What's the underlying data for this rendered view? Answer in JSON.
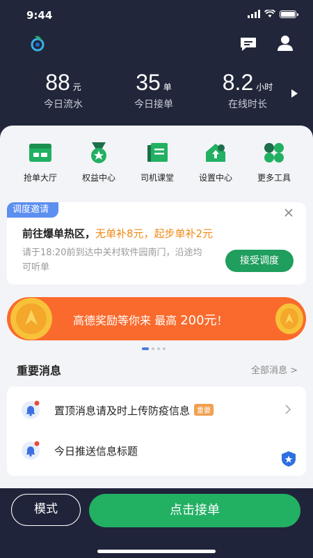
{
  "status": {
    "time": "9:44"
  },
  "stats": [
    {
      "value": "88",
      "unit": "元",
      "label": "今日流水"
    },
    {
      "value": "35",
      "unit": "单",
      "label": "今日接单"
    },
    {
      "value": "8.2",
      "unit": "小时",
      "label": "在线时长"
    }
  ],
  "tools": [
    {
      "label": "抢单大厅",
      "icon": "hall-icon"
    },
    {
      "label": "权益中心",
      "icon": "medal-icon"
    },
    {
      "label": "司机课堂",
      "icon": "book-icon"
    },
    {
      "label": "设置中心",
      "icon": "settings-house-icon"
    },
    {
      "label": "更多工具",
      "icon": "more-tools-icon"
    }
  ],
  "dispatch": {
    "tag": "调度邀请",
    "title": "前往爆单热区，",
    "highlight": "无单补8元，起步单补2元",
    "desc": "请于18:20前到达中关村软件园南门，沿途均可听单",
    "accept": "接受调度"
  },
  "banner": {
    "text": "高德奖励等你来 最高 ",
    "amount": "200元",
    "suffix": "！"
  },
  "messages": {
    "title": "重要消息",
    "all": "全部消息 >",
    "items": [
      {
        "text": "置顶消息请及时上传防疫信息",
        "badge": "重要"
      },
      {
        "text": "今日推送信息标题"
      }
    ]
  },
  "bottom": {
    "mode": "模式",
    "go": "点击接单"
  },
  "colors": {
    "accent_green": "#22b063",
    "header_bg": "#21263a",
    "orange": "#fa6a2c",
    "tag_blue": "#5b8ff0"
  }
}
